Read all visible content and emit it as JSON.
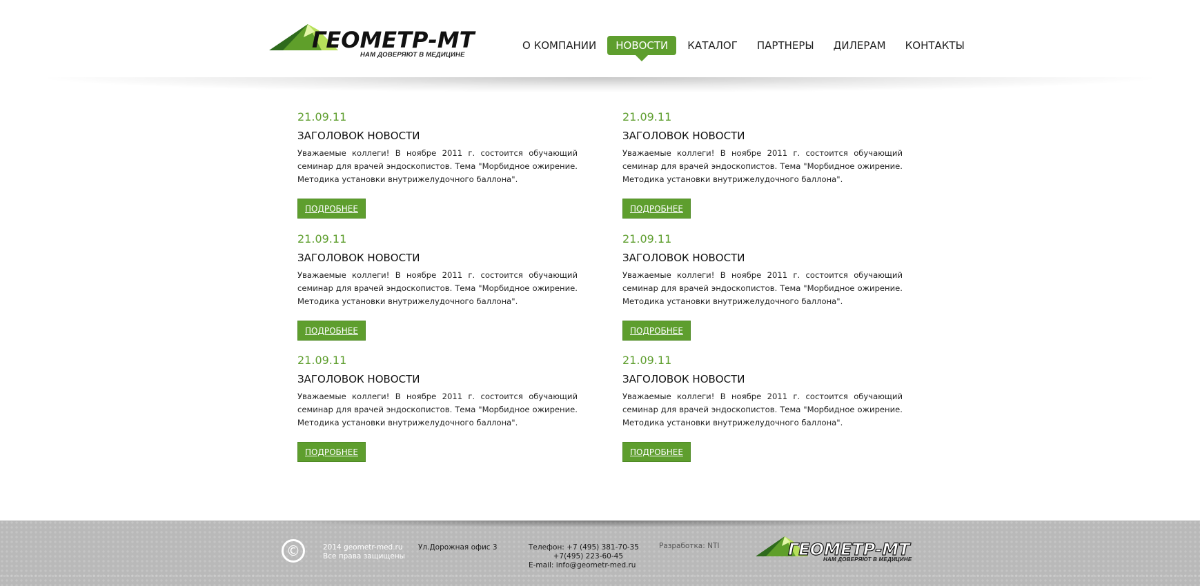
{
  "header": {
    "logo": {
      "brand": "ГЕОМЕТР-МТ",
      "tagline": "НАМ ДОВЕРЯЮТ В МЕДИЦИНЕ"
    },
    "nav": [
      {
        "label": "О КОМПАНИИ",
        "active": false
      },
      {
        "label": "НОВОСТИ",
        "active": true
      },
      {
        "label": "КАТАЛОГ",
        "active": false
      },
      {
        "label": "ПАРТНЕРЫ",
        "active": false
      },
      {
        "label": "ДИЛЕРАМ",
        "active": false
      },
      {
        "label": "КОНТАКТЫ",
        "active": false
      }
    ]
  },
  "news": [
    {
      "date": "21.09.11",
      "title": "ЗАГОЛОВОК НОВОСТИ",
      "text": "Уважаемые коллеги! В ноябре 2011 г. состоится обучающий семинар для врачей эндоскопистов. Тема \"Морбидное ожирение. Методика установки внутрижелудочного баллона\".",
      "button": "ПОДРОБНЕЕ"
    },
    {
      "date": "21.09.11",
      "title": "ЗАГОЛОВОК НОВОСТИ",
      "text": "Уважаемые коллеги! В ноябре 2011 г. состоится обучающий семинар для врачей эндоскопистов. Тема \"Морбидное ожирение. Методика установки внутрижелудочного баллона\".",
      "button": "ПОДРОБНЕЕ"
    },
    {
      "date": "21.09.11",
      "title": "ЗАГОЛОВОК НОВОСТИ",
      "text": "Уважаемые коллеги! В ноябре 2011 г. состоится обучающий семинар для врачей эндоскопистов. Тема \"Морбидное ожирение. Методика установки внутрижелудочного баллона\".",
      "button": "ПОДРОБНЕЕ"
    },
    {
      "date": "21.09.11",
      "title": "ЗАГОЛОВОК НОВОСТИ",
      "text": "Уважаемые коллеги! В ноябре 2011 г. состоится обучающий семинар для врачей эндоскопистов. Тема \"Морбидное ожирение. Методика установки внутрижелудочного баллона\".",
      "button": "ПОДРОБНЕЕ"
    },
    {
      "date": "21.09.11",
      "title": "ЗАГОЛОВОК НОВОСТИ",
      "text": "Уважаемые коллеги! В ноябре 2011 г. состоится обучающий семинар для врачей эндоскопистов. Тема \"Морбидное ожирение. Методика установки внутрижелудочного баллона\".",
      "button": "ПОДРОБНЕЕ"
    },
    {
      "date": "21.09.11",
      "title": "ЗАГОЛОВОК НОВОСТИ",
      "text": "Уважаемые коллеги! В ноябре 2011 г. состоится обучающий семинар для врачей эндоскопистов. Тема \"Морбидное ожирение. Методика установки внутрижелудочного баллона\".",
      "button": "ПОДРОБНЕЕ"
    }
  ],
  "footer": {
    "copyright_symbol": "©",
    "site": "2014 geometr-med.ru",
    "rights": "Все права защищены",
    "address": "Ул.Дорожная  офис 3",
    "phone_1": "Телефон: +7 (495) 381-70-35",
    "phone_2": "+7(495) 223-60-45",
    "email": "E-mail: info@geometr-med.ru",
    "developer": "Разработка: NTI",
    "logo": {
      "brand": "ГЕОМЕТР-МТ",
      "tagline": "НАМ ДОВЕРЯЮТ В МЕДИЦИНЕ"
    }
  },
  "colors": {
    "accent": "#5e9e2e",
    "footer_bg": "#b9b9b9",
    "text": "#1d1d1d"
  }
}
